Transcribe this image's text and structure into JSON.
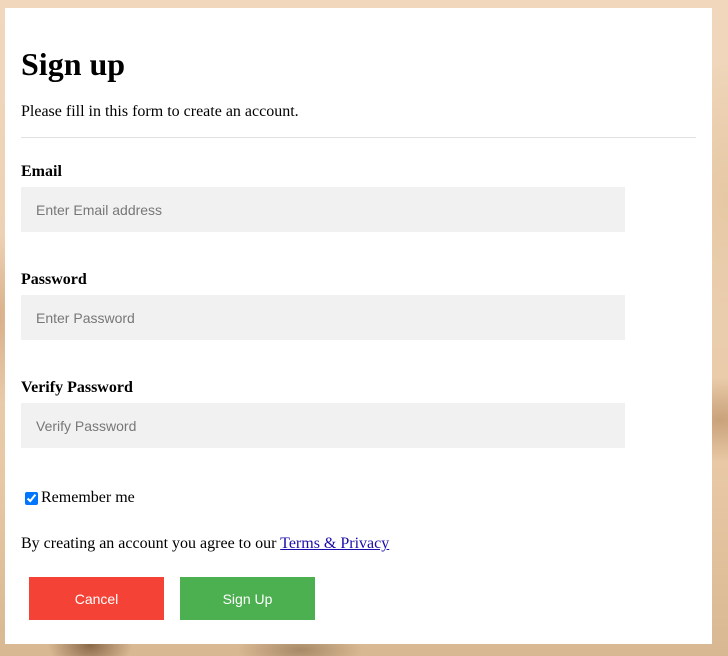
{
  "form": {
    "title": "Sign up",
    "intro": "Please fill in this form to create an account.",
    "email": {
      "label": "Email",
      "placeholder": "Enter Email address",
      "value": ""
    },
    "password": {
      "label": "Password",
      "placeholder": "Enter Password",
      "value": ""
    },
    "verify_password": {
      "label": "Verify Password",
      "placeholder": "Verify Password",
      "value": ""
    },
    "remember": {
      "label": "Remember me",
      "checked": true
    },
    "agreement": {
      "text": "By creating an account you agree to our ",
      "link_text": "Terms & Privacy"
    },
    "buttons": {
      "cancel": "Cancel",
      "signup": "Sign Up"
    }
  },
  "colors": {
    "cancel_bg": "#f44336",
    "signup_bg": "#4caf50",
    "input_bg": "#f1f1f1",
    "link": "#1a0dab"
  }
}
